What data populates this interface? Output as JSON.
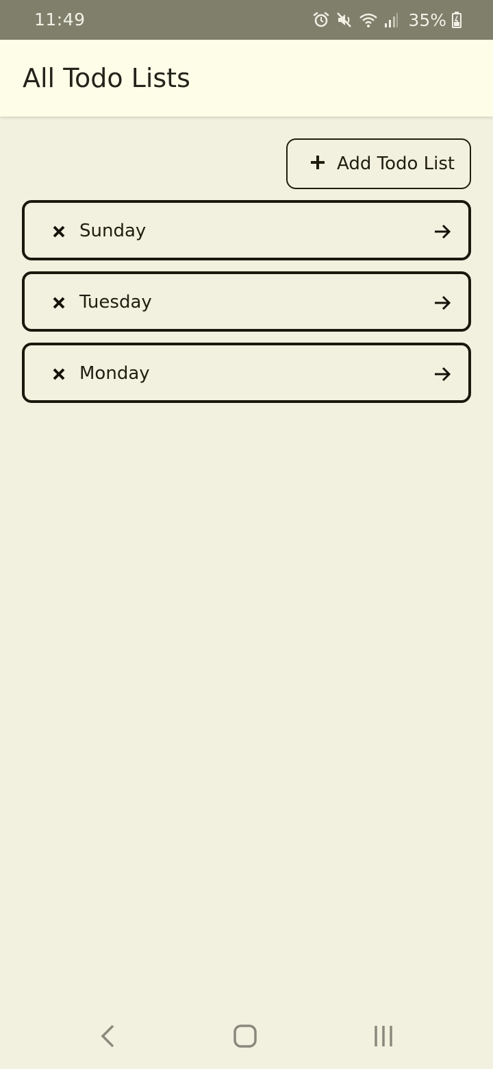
{
  "status_bar": {
    "time": "11:49",
    "battery": "35%",
    "icons": [
      "alarm-icon",
      "mute-icon",
      "wifi-icon",
      "signal-icon",
      "battery-icon"
    ]
  },
  "app_bar": {
    "title": "All Todo Lists"
  },
  "add_button": {
    "label": "Add Todo List",
    "icon": "plus-icon"
  },
  "todo_lists": [
    {
      "label": "Sunday"
    },
    {
      "label": "Tuesday"
    },
    {
      "label": "Monday"
    }
  ],
  "nav_bar": {
    "buttons": [
      "back-icon",
      "home-icon",
      "recents-icon"
    ]
  },
  "colors": {
    "status_bar_bg": "#7f7f6c",
    "app_bar_bg": "#fefee8",
    "page_bg": "#f2f0de",
    "border": "#1a180c"
  }
}
